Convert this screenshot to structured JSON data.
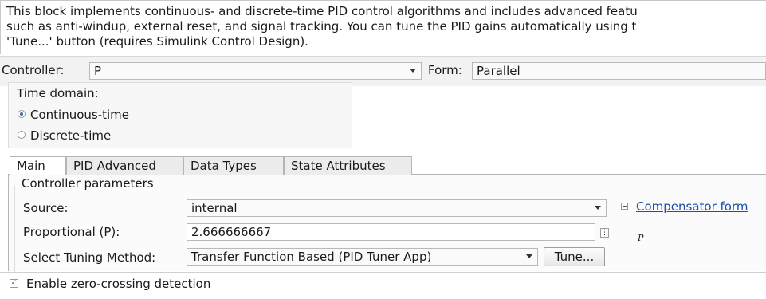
{
  "description": {
    "lines": [
      "This block implements continuous- and discrete-time PID control algorithms and includes advanced featu",
      "such as anti-windup, external reset, and signal tracking. You can tune the PID gains automatically using t",
      "'Tune...' button (requires Simulink Control Design)."
    ]
  },
  "controller": {
    "label": "Controller:",
    "value": "P",
    "form_label": "Form:",
    "form_value": "Parallel"
  },
  "time_domain": {
    "label": "Time domain:",
    "options": [
      {
        "label": "Continuous-time",
        "selected": true
      },
      {
        "label": "Discrete-time",
        "selected": false
      }
    ]
  },
  "tabs": [
    {
      "label": "Main",
      "active": true
    },
    {
      "label": "PID Advanced",
      "active": false
    },
    {
      "label": "Data Types",
      "active": false
    },
    {
      "label": "State Attributes",
      "active": false
    }
  ],
  "parameters": {
    "group_label": "Controller parameters",
    "source_label": "Source:",
    "source_value": "internal",
    "proportional_label": "Proportional (P):",
    "proportional_value": "2.666666667",
    "tuning_label": "Select Tuning Method:",
    "tuning_value": "Transfer Function Based (PID Tuner App)",
    "tune_button": "Tune...",
    "compensator_link": "Compensator form",
    "formula_symbol": "P"
  },
  "zero_crossing": {
    "label": "Enable zero-crossing detection",
    "checked": true
  },
  "colors": {
    "link": "#1a4fb3",
    "radio_accent": "#3b6ea5"
  }
}
